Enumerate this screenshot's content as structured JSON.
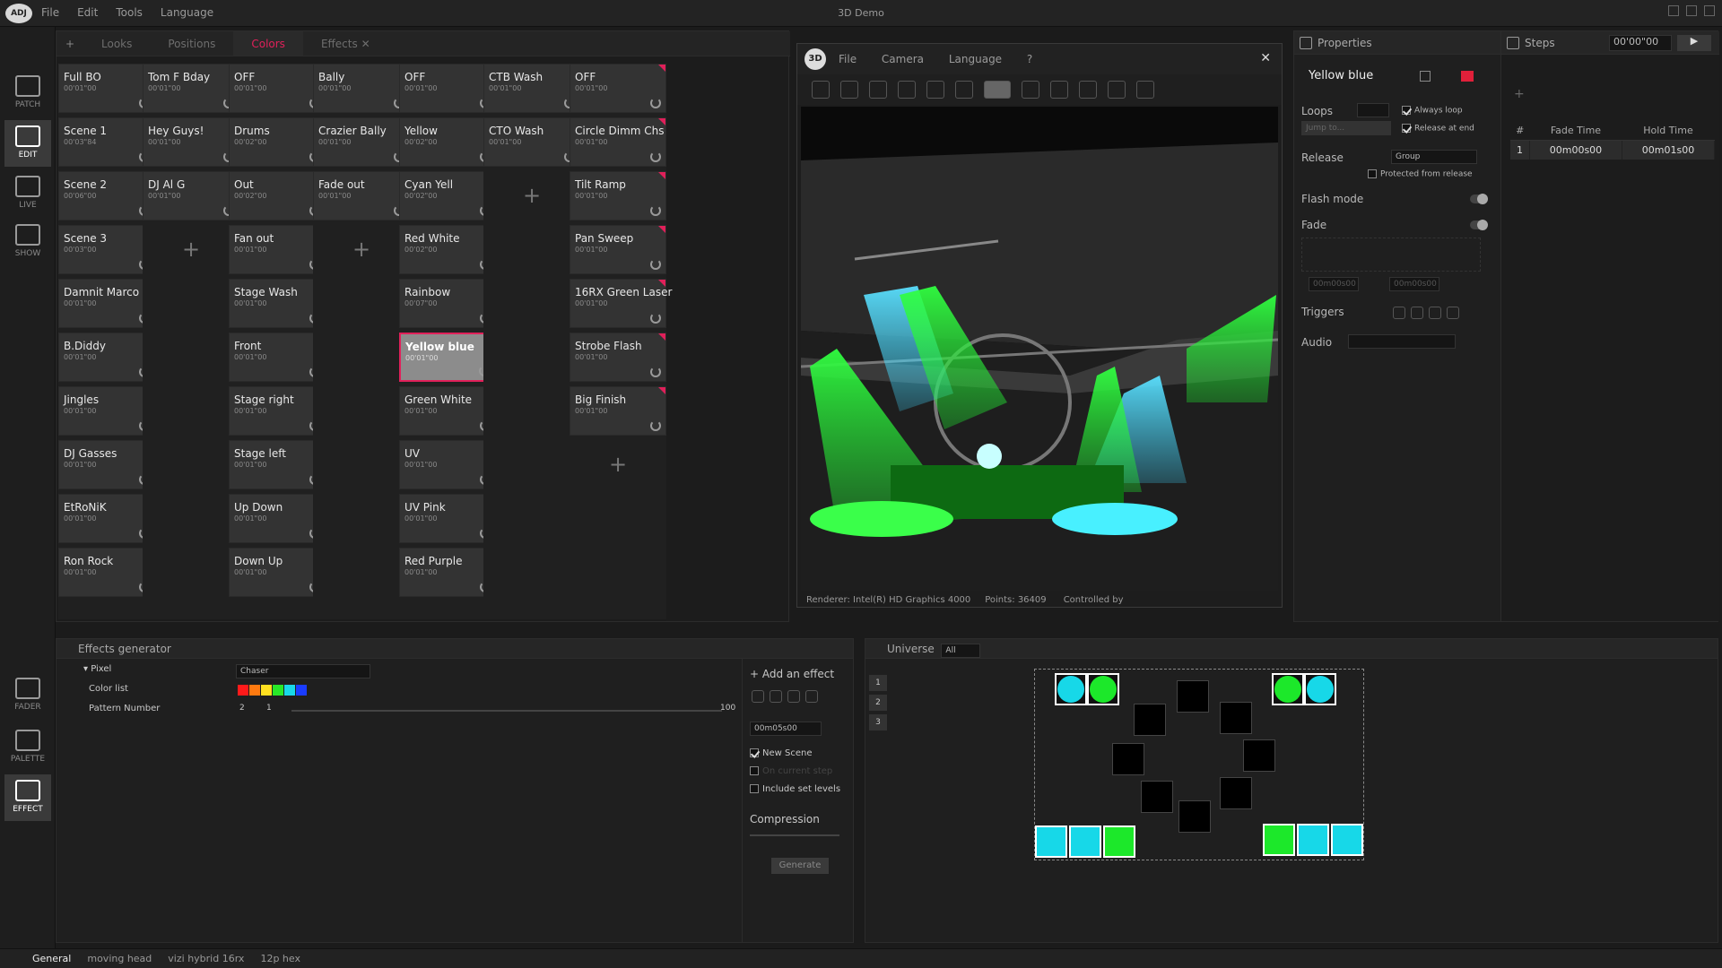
{
  "app": {
    "title": "3D Demo",
    "menu": [
      "File",
      "Edit",
      "Tools",
      "Language"
    ],
    "logo": "ADJ"
  },
  "leftnav": [
    {
      "label": "PATCH",
      "icon": "patch-icon"
    },
    {
      "label": "EDIT",
      "icon": "edit-icon"
    },
    {
      "label": "LIVE",
      "icon": "live-icon"
    },
    {
      "label": "SHOW",
      "icon": "show-icon"
    }
  ],
  "leftnav2": [
    {
      "label": "FADER",
      "icon": "fader-icon"
    },
    {
      "label": "PALETTE",
      "icon": "palette-icon"
    },
    {
      "label": "EFFECT",
      "icon": "effect-icon"
    }
  ],
  "tabs": [
    "Looks",
    "Positions",
    "Colors",
    "Effects"
  ],
  "active_tab": "Colors",
  "columns": [
    [
      [
        "Full BO",
        "00'01\"00"
      ],
      [
        "Scene 1",
        "00'03\"84"
      ],
      [
        "Scene 2",
        "00'06\"00"
      ],
      [
        "Scene 3",
        "00'03\"00"
      ],
      [
        "Damnit Marco",
        "00'01\"00"
      ],
      [
        "B.Diddy",
        "00'01\"00"
      ],
      [
        "Jingles",
        "00'01\"00"
      ],
      [
        "DJ Gasses",
        "00'01\"00"
      ],
      [
        "EtRoNiK",
        "00'01\"00"
      ],
      [
        "Ron Rock",
        "00'01\"00"
      ]
    ],
    [
      [
        "Tom F Bday",
        "00'01\"00"
      ],
      [
        "Hey Guys!",
        "00'01\"00"
      ],
      [
        "DJ Al G",
        "00'01\"00"
      ]
    ],
    [
      [
        "OFF",
        "00'01\"00"
      ],
      [
        "Drums",
        "00'02\"00"
      ],
      [
        "Out",
        "00'02\"00"
      ],
      [
        "Fan out",
        "00'01\"00"
      ],
      [
        "Stage Wash",
        "00'01\"00"
      ],
      [
        "Front",
        "00'01\"00"
      ],
      [
        "Stage right",
        "00'01\"00"
      ],
      [
        "Stage left",
        "00'01\"00"
      ],
      [
        "Up Down",
        "00'01\"00"
      ],
      [
        "Down Up",
        "00'01\"00"
      ]
    ],
    [
      [
        "Bally",
        "00'01\"00"
      ],
      [
        "Crazier Bally",
        "00'01\"00"
      ],
      [
        "Fade out",
        "00'01\"00"
      ]
    ],
    [
      [
        "OFF",
        "00'01\"00"
      ],
      [
        "Yellow",
        "00'02\"00"
      ],
      [
        "Cyan Yell",
        "00'02\"00"
      ],
      [
        "Red White",
        "00'02\"00"
      ],
      [
        "Rainbow",
        "00'07\"00"
      ],
      [
        "Yellow blue",
        "00'01\"00"
      ],
      [
        "Green White",
        "00'01\"00"
      ],
      [
        "UV",
        "00'01\"00"
      ],
      [
        "UV Pink",
        "00'01\"00"
      ],
      [
        "Red Purple",
        "00'01\"00"
      ]
    ],
    [
      [
        "CTB Wash",
        "00'01\"00"
      ],
      [
        "CTO Wash",
        "00'01\"00"
      ]
    ],
    [
      [
        "OFF",
        "00'01\"00"
      ],
      [
        "Circle Dimm Chs",
        "00'01\"00"
      ],
      [
        "Tilt Ramp",
        "00'01\"00"
      ],
      [
        "Pan Sweep",
        "00'01\"00"
      ],
      [
        "16RX Green Laser",
        "00'01\"00"
      ],
      [
        "Strobe Flash",
        "00'01\"00"
      ],
      [
        "Big Finish",
        "00'01\"00"
      ]
    ]
  ],
  "viewer": {
    "badge": "3D",
    "menu": [
      "File",
      "Camera",
      "Language",
      "?"
    ],
    "renderer_label": "Renderer:",
    "renderer": "Intel(R) HD Graphics 4000",
    "points_label": "Points:",
    "points": "36409",
    "controlled_label": "Controlled by"
  },
  "properties": {
    "title": "Properties",
    "scene_name": "Yellow blue",
    "loops_label": "Loops",
    "always_loop": "Always loop",
    "release_at_end": "Release at end",
    "jump_to": "Jump to...",
    "release_label": "Release",
    "release_value": "Group",
    "protected": "Protected from release",
    "flash_mode": "Flash mode",
    "fade": "Fade",
    "fade_in": "00m00s00",
    "fade_out": "00m00s00",
    "triggers": "Triggers",
    "audio": "Audio"
  },
  "steps": {
    "title": "Steps",
    "time": "00'00\"00",
    "cols": [
      "#",
      "Fade Time",
      "Hold Time"
    ],
    "rows": [
      [
        "1",
        "00m00s00",
        "00m01s00"
      ]
    ]
  },
  "effects": {
    "title": "Effects generator",
    "group": "Pixel",
    "effect_type": "Chaser",
    "color_list_label": "Color list",
    "colors": [
      "#ff1a1a",
      "#ff7a10",
      "#ffe020",
      "#28e828",
      "#18d8e8",
      "#1a3cff"
    ],
    "pattern_label": "Pattern Number",
    "pattern_min": "2",
    "pattern_val": "1",
    "pattern_max": "100",
    "add_effect": "Add an effect",
    "duration": "00m05s00",
    "new_scene": "New Scene",
    "on_current_step": "On current step",
    "include_set_levels": "Include set levels",
    "compression": "Compression",
    "generate": "Generate"
  },
  "universe": {
    "title": "Universe",
    "filter": "All",
    "pages": [
      "1",
      "2",
      "3"
    ]
  },
  "bottom": [
    "General",
    "moving head",
    "vizi hybrid 16rx",
    "12p hex"
  ]
}
